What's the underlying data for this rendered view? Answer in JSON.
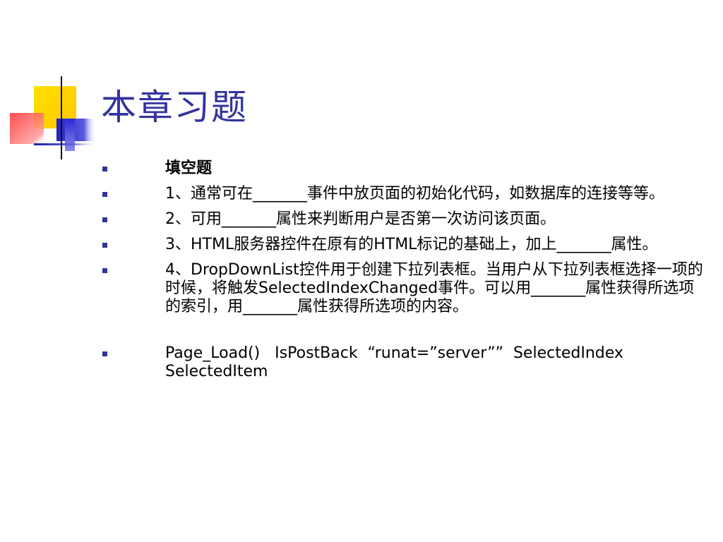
{
  "slide": {
    "title": "本章习题",
    "items": [
      {
        "text": "填空题",
        "bold": true
      },
      {
        "text": "1、通常可在_______事件中放页面的初始化代码，如数据库的连接等等。"
      },
      {
        "text": "2、可用_______属性来判断用户是否第一次访问该页面。"
      },
      {
        "text": "3、HTML服务器控件在原有的HTML标记的基础上，加上_______属性。"
      },
      {
        "text": "4、DropDownList控件用于创建下拉列表框。当用户从下拉列表框选择一项的时候，将触发SelectedIndexChanged事件。可以用_______属性获得所选项的索引，用_______属性获得所选项的内容。"
      },
      {
        "text": "Page_Load()   IsPostBack  “runat=”server””  SelectedIndex  SelectedItem"
      }
    ]
  },
  "colors": {
    "title": "#3333a0",
    "bullet": "#333399",
    "deco_yellow": "#ffd700",
    "deco_blue": "#3a3ad0",
    "deco_red": "#ff3a3a"
  }
}
